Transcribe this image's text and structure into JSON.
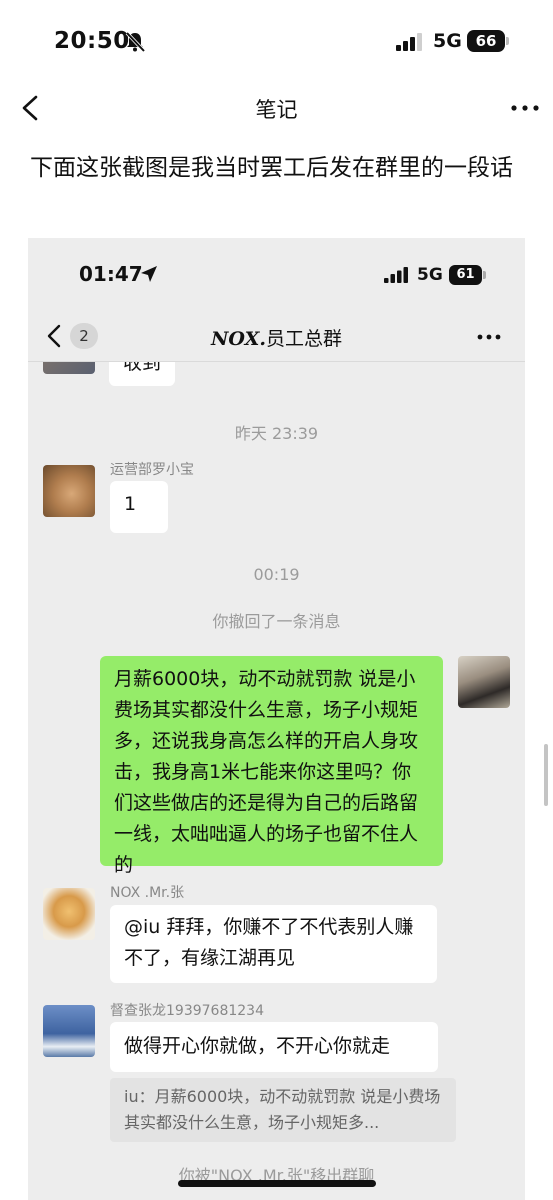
{
  "status_bar": {
    "time": "20:50",
    "network": "5G",
    "battery": "66",
    "icons": [
      "bell-slash-icon",
      "signal-icon",
      "battery-icon"
    ]
  },
  "nav": {
    "title": "笔记",
    "back_icon": "chevron-left-icon",
    "more_icon": "more-icon"
  },
  "note": {
    "text": "下面这张截图是我当时罢工后发在群里的一段话"
  },
  "screenshot": {
    "status_bar": {
      "time": "01:47",
      "network": "5G",
      "battery": "61",
      "icons": [
        "location-arrow-icon",
        "signal-icon",
        "battery-icon"
      ]
    },
    "nav": {
      "unread": "2",
      "title_brand": "NOX.",
      "title_rest": "员工总群"
    },
    "messages": {
      "partial_bubble": "收到",
      "time_1": "昨天 23:39",
      "msg1": {
        "sender": "运营部罗小宝",
        "text": "1"
      },
      "time_2": "00:19",
      "recall": "你撤回了一条消息",
      "mine": {
        "text": "月薪6000块，动不动就罚款 说是小费场其实都没什么生意，场子小规矩多，还说我身高怎么样的开启人身攻击，我身高1米七能来你这里吗？你们这些做店的还是得为自己的后路留一线，太咄咄逼人的场子也留不住人的"
      },
      "msg2": {
        "sender": "NOX .Mr.张",
        "text": "@iu 拜拜，你赚不了不代表别人赚不了，有缘江湖再见"
      },
      "msg3": {
        "sender": "督查张龙19397681234",
        "text": "做得开心你就做，不开心你就走",
        "quote": "iu：月薪6000块，动不动就罚款 说是小费场其实都没什么生意，场子小规矩多..."
      },
      "system_end": "你被\"NOX .Mr.张\"移出群聊"
    }
  },
  "colors": {
    "mine_bubble": "#95ec69",
    "chat_bg": "#ededed",
    "bubble": "#ffffff"
  }
}
